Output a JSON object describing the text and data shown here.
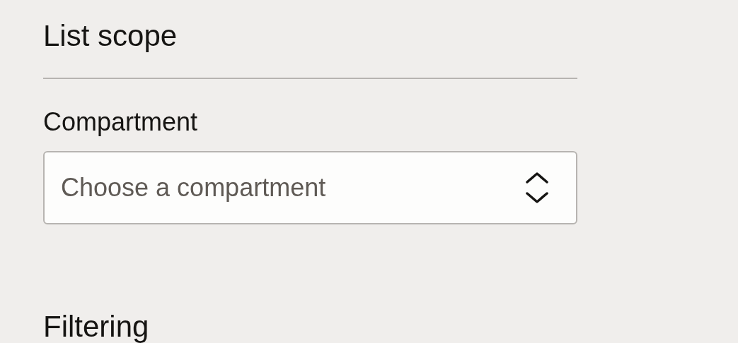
{
  "sections": [
    {
      "title": "List scope",
      "fields": [
        {
          "label": "Compartment",
          "kind": "select",
          "placeholder": "Choose a compartment"
        }
      ]
    },
    {
      "title": "Filtering"
    }
  ]
}
